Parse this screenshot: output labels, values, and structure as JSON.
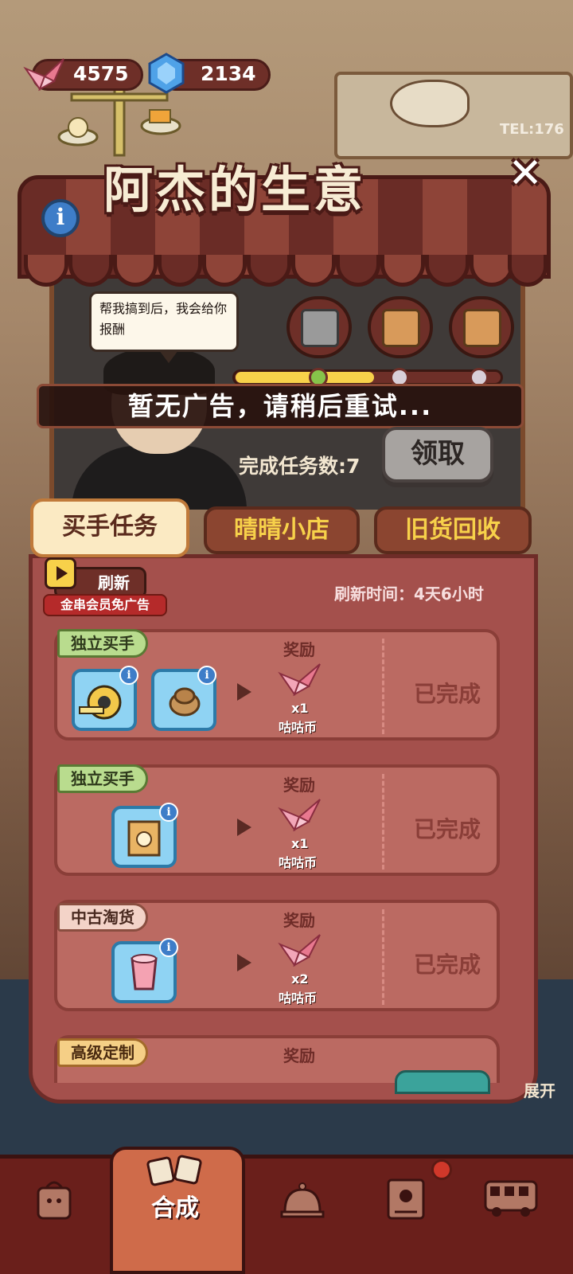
{
  "currency": {
    "crane_coins": "4575",
    "gems": "2134"
  },
  "background": {
    "shop_sign": "TEL:176"
  },
  "panel": {
    "title": "阿杰的生意",
    "speech": "帮我搞到后，我会给你报酬",
    "toast": "暂无广告，请稍后重试...",
    "completed_tasks": "完成任务数:7",
    "claim_button": "领取",
    "progress": 0.52
  },
  "tabs": [
    {
      "label": "买手任务",
      "active": true
    },
    {
      "label": "晴晴小店",
      "active": false
    },
    {
      "label": "旧货回收",
      "active": false
    }
  ],
  "refresh": {
    "button": "刷新",
    "vip_note": "金串会员免广告",
    "time": "刷新时间：4天6小时"
  },
  "tasks": [
    {
      "tag": "独立买手",
      "reward_label": "奖励",
      "qty": "x1",
      "reward_name": "咕咕币",
      "status": "已完成",
      "items": [
        "tape-measure",
        "rope-coil"
      ]
    },
    {
      "tag": "独立买手",
      "reward_label": "奖励",
      "qty": "x1",
      "reward_name": "咕咕币",
      "status": "已完成",
      "items": [
        "paper-bag-socket"
      ]
    },
    {
      "tag": "中古淘货",
      "reward_label": "奖励",
      "qty": "x2",
      "reward_name": "咕咕币",
      "status": "已完成",
      "items": [
        "pink-cup"
      ]
    },
    {
      "tag": "高级定制",
      "reward_label": "奖励"
    }
  ],
  "side": {
    "expand": "展开"
  },
  "nav": [
    {
      "icon": "bag-icon"
    },
    {
      "icon": "merge-icon",
      "label": "合成",
      "active": true
    },
    {
      "icon": "service-bell-icon"
    },
    {
      "icon": "map-icon"
    },
    {
      "icon": "bus-icon"
    }
  ],
  "colors": {
    "accent_yellow": "#f7d14a",
    "panel_red": "#a4504c",
    "awning_dark": "#6a2c26"
  }
}
